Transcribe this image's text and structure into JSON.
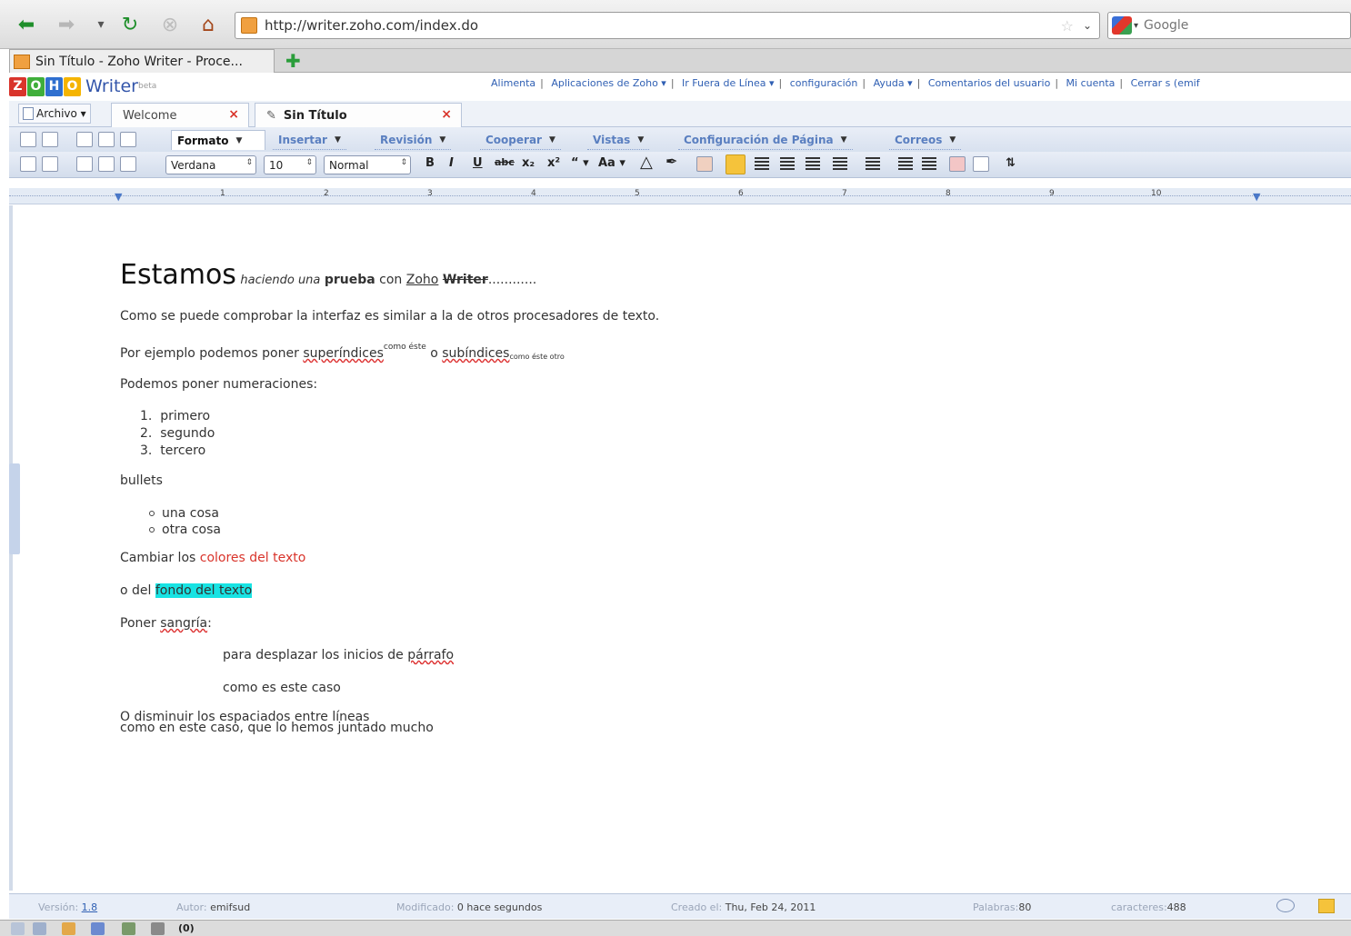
{
  "browser": {
    "url": "http://writer.zoho.com/index.do",
    "search_placeholder": "Google",
    "tab_title": "Sin Título - Zoho Writer - Proce..."
  },
  "app": {
    "logo_letters": [
      "Z",
      "O",
      "H",
      "O"
    ],
    "product_name": "Writer",
    "beta": "beta",
    "top_links": [
      "Alimenta",
      "Aplicaciones de Zoho ▾",
      "Ir Fuera de Línea ▾",
      "configuración",
      "Ayuda ▾",
      "Comentarios del usuario",
      "Mi cuenta",
      "Cerrar s (emif"
    ]
  },
  "doc_tabs": {
    "archivo": "Archivo ▾",
    "welcome": "Welcome",
    "current": "Sin Título"
  },
  "menus": {
    "formato": "Formato",
    "insertar": "Insertar",
    "revision": "Revisión",
    "cooperar": "Cooperar",
    "vistas": "Vistas",
    "configuracion": "Configuración de Página",
    "correos": "Correos"
  },
  "format_bar": {
    "font": "Verdana",
    "size": "10",
    "style": "Normal",
    "font_case": "Aa ▾"
  },
  "ruler_numbers": [
    "1",
    "2",
    "3",
    "4",
    "5",
    "6",
    "7",
    "8",
    "9",
    "10"
  ],
  "document": {
    "heading_big": "Estamos",
    "heading_word1": "haciendo una",
    "heading_bold": "prueba",
    "heading_word2": "con",
    "heading_zoho": "Zoho",
    "heading_writer": "Writer",
    "heading_dots": "............",
    "p1": "Como se puede comprobar la interfaz es similar a la de otros procesadores de texto.",
    "p2_start": "Por ejemplo podemos poner",
    "p2_sup_word": "superíndices",
    "p2_sup": "como éste",
    "p2_mid": "o",
    "p2_sub_word": "subíndices",
    "p2_sub": "como éste otro",
    "p3": "Podemos poner numeraciones:",
    "ordered": [
      "primero",
      "segundo",
      "tercero"
    ],
    "p4": "bullets",
    "bulleted": [
      "una cosa",
      "otra cosa"
    ],
    "p5_start": "Cambiar los",
    "p5_red": "colores del texto",
    "p6_start": "o del",
    "p6_highlight": "fondo del texto",
    "p7_start": "Poner",
    "p7_word": "sangría",
    "p7_end": ":",
    "p8_start": "para desplazar los inicios de",
    "p8_word": "párrafo",
    "p9": "como es este caso",
    "p10a": "O disminuir los espaciados entre líneas",
    "p10b": "como en este caso, que lo hemos juntado mucho"
  },
  "status": {
    "version_label": "Versión:",
    "version_value": "1.8",
    "author_label": "Autor:",
    "author_value": "emifsud",
    "modified_label": "Modificado:",
    "modified_value": "0 hace segundos",
    "created_label": "Creado el:",
    "created_value": "Thu, Feb 24, 2011",
    "words_label": "Palabras:",
    "words_value": "80",
    "chars_label": "caracteres:",
    "chars_value": "488"
  },
  "browser_status": {
    "count": "(0)"
  },
  "colors": {
    "accent_blue": "#2f5fb3",
    "text_red": "#d9342b",
    "highlight_cyan": "#18e3e3",
    "toolbar_bg": "#dfe6f2"
  }
}
